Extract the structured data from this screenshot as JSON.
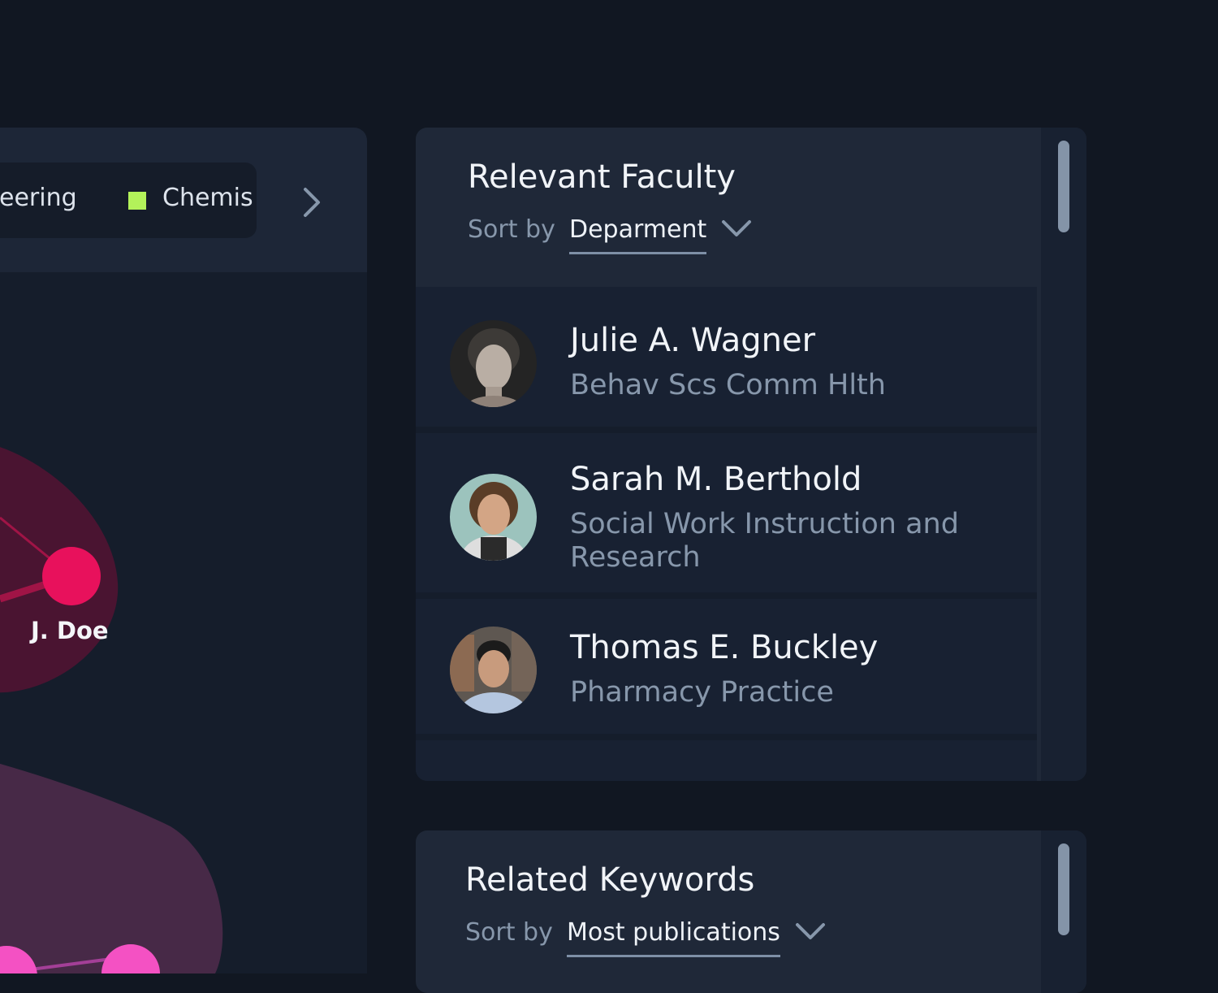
{
  "graph": {
    "legend": {
      "items": [
        {
          "label": "neering",
          "color": ""
        },
        {
          "label": "Chemis",
          "color": "#b3f25a"
        }
      ],
      "next_icon": "chevron-right-icon"
    },
    "node_label": "J. Doe",
    "colors": {
      "blob_primary": "#4a1431",
      "blob_secondary": "#472947",
      "node_primary": "#e8115c",
      "node_secondary": "#f451c3"
    }
  },
  "faculty": {
    "title": "Relevant Faculty",
    "sort_label": "Sort by",
    "sort_value": "Deparment",
    "sort_icon": "chevron-down-icon",
    "members": [
      {
        "name": "Julie A. Wagner",
        "department": "Behav Scs Comm Hlth"
      },
      {
        "name": "Sarah M. Berthold",
        "department": "Social Work Instruction and Research"
      },
      {
        "name": "Thomas E. Buckley",
        "department": "Pharmacy Practice"
      }
    ]
  },
  "keywords": {
    "title": "Related Keywords",
    "sort_label": "Sort by",
    "sort_value": "Most publications",
    "sort_icon": "chevron-down-icon"
  }
}
